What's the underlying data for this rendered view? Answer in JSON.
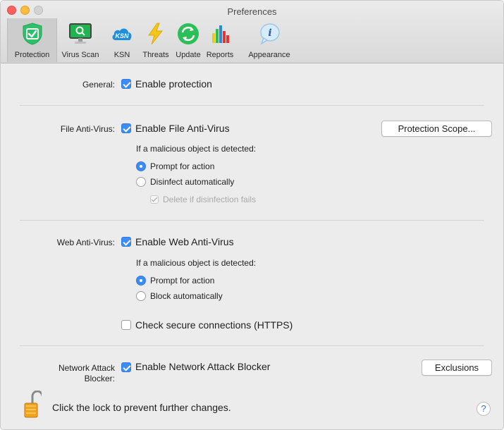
{
  "window": {
    "title": "Preferences"
  },
  "toolbar": {
    "tabs": [
      {
        "label": "Protection",
        "icon": "shield-icon",
        "selected": true
      },
      {
        "label": "Virus Scan",
        "icon": "monitor-scan-icon"
      },
      {
        "label": "KSN",
        "icon": "ksn-cloud-icon",
        "icon_text": "KSN"
      },
      {
        "label": "Threats",
        "icon": "lightning-icon"
      },
      {
        "label": "Update",
        "icon": "update-arrows-icon"
      },
      {
        "label": "Reports",
        "icon": "bar-chart-icon"
      },
      {
        "label": "Appearance",
        "icon": "info-bubble-icon",
        "icon_text": "i"
      }
    ]
  },
  "general": {
    "label": "General:",
    "enable_protection": {
      "label": "Enable protection",
      "checked": true
    }
  },
  "file_av": {
    "label": "File Anti-Virus:",
    "enable": {
      "label": "Enable File Anti-Virus",
      "checked": true
    },
    "scope_button": "Protection Scope...",
    "detected_label": "If a malicious object is detected:",
    "options": [
      {
        "label": "Prompt for action",
        "selected": true
      },
      {
        "label": "Disinfect automatically",
        "selected": false
      }
    ],
    "delete_if_fails": {
      "label": "Delete if disinfection fails",
      "checked": true,
      "disabled": true
    }
  },
  "web_av": {
    "label": "Web Anti-Virus:",
    "enable": {
      "label": "Enable Web Anti-Virus",
      "checked": true
    },
    "detected_label": "If a malicious object is detected:",
    "options": [
      {
        "label": "Prompt for action",
        "selected": true
      },
      {
        "label": "Block automatically",
        "selected": false
      }
    ],
    "https": {
      "label": "Check secure connections (HTTPS)",
      "checked": false
    }
  },
  "network": {
    "label_line1": "Network Attack",
    "label_line2": "Blocker:",
    "enable": {
      "label": "Enable Network Attack Blocker",
      "checked": true
    },
    "exclusions_button": "Exclusions"
  },
  "footer": {
    "lock_text": "Click the lock to prevent further changes.",
    "help": "?"
  },
  "colors": {
    "accent": "#3b8cf4",
    "shield_green": "#2fc06a",
    "update_green": "#2bbf57"
  }
}
